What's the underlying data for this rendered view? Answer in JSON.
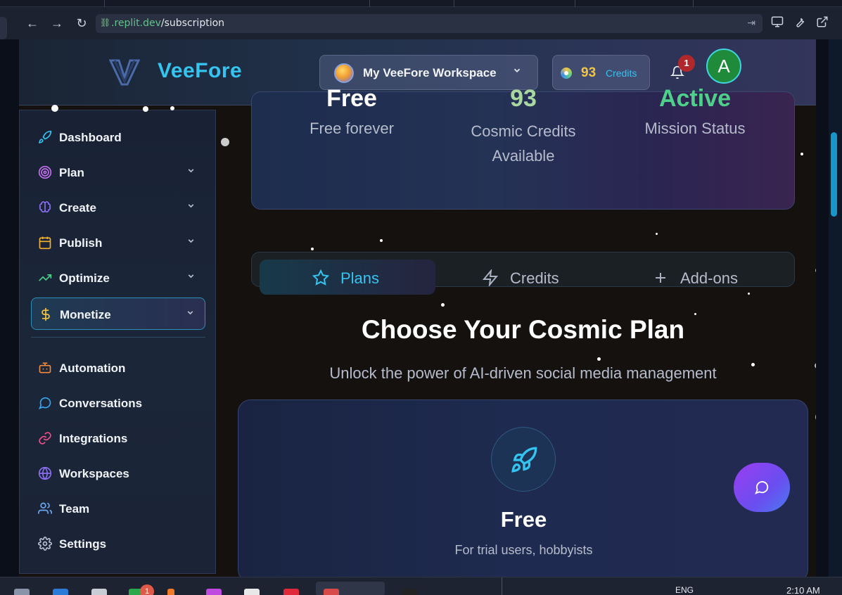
{
  "browser": {
    "url_host": ".replit.dev",
    "url_path": "/subscription"
  },
  "header": {
    "brand": "VeeFore",
    "workspace_name": "My VeeFore Workspace",
    "credits_count": "93",
    "credits_label": "Credits",
    "notifications_count": "1",
    "avatar_initial": "A"
  },
  "sidebar": {
    "items": [
      {
        "label": "Dashboard",
        "icon": "rocket-icon",
        "color": "#35c4f0"
      },
      {
        "label": "Plan",
        "icon": "target-icon",
        "color": "#c46ef0"
      },
      {
        "label": "Create",
        "icon": "brain-icon",
        "color": "#8a6ef0"
      },
      {
        "label": "Publish",
        "icon": "calendar-icon",
        "color": "#f5b230"
      },
      {
        "label": "Optimize",
        "icon": "trending-up-icon",
        "color": "#4ed08a"
      },
      {
        "label": "Monetize",
        "icon": "dollar-icon",
        "color": "#f5c542"
      },
      {
        "label": "Automation",
        "icon": "bot-icon",
        "color": "#f08a3a"
      },
      {
        "label": "Conversations",
        "icon": "message-circle-icon",
        "color": "#35a8f0"
      },
      {
        "label": "Integrations",
        "icon": "link-icon",
        "color": "#f0508a"
      },
      {
        "label": "Workspaces",
        "icon": "globe-icon",
        "color": "#8a6ef0"
      },
      {
        "label": "Team",
        "icon": "users-icon",
        "color": "#6ea8f0"
      },
      {
        "label": "Settings",
        "icon": "gear-icon",
        "color": "#b8c0d0"
      }
    ]
  },
  "stats": [
    {
      "value": "Free",
      "label": "Free forever",
      "color": "#ffffff"
    },
    {
      "value": "93",
      "label": "Cosmic Credits Available",
      "color": "#a8d8a0"
    },
    {
      "value": "Active",
      "label": "Mission Status",
      "color": "#4ed08a"
    }
  ],
  "tabs": [
    {
      "label": "Plans",
      "icon": "star-icon"
    },
    {
      "label": "Credits",
      "icon": "zap-icon"
    },
    {
      "label": "Add-ons",
      "icon": "plus-icon"
    }
  ],
  "page": {
    "title": "Choose Your Cosmic Plan",
    "subtitle": "Unlock the power of AI-driven social media management"
  },
  "plan": {
    "name": "Free",
    "description": "For trial users, hobbyists"
  },
  "taskbar": {
    "badge": "1",
    "lang": "ENG",
    "time": "2:10 AM"
  },
  "colors": {
    "accent": "#35c4f0",
    "credits": "#f5c542",
    "active_status": "#4ed08a"
  }
}
